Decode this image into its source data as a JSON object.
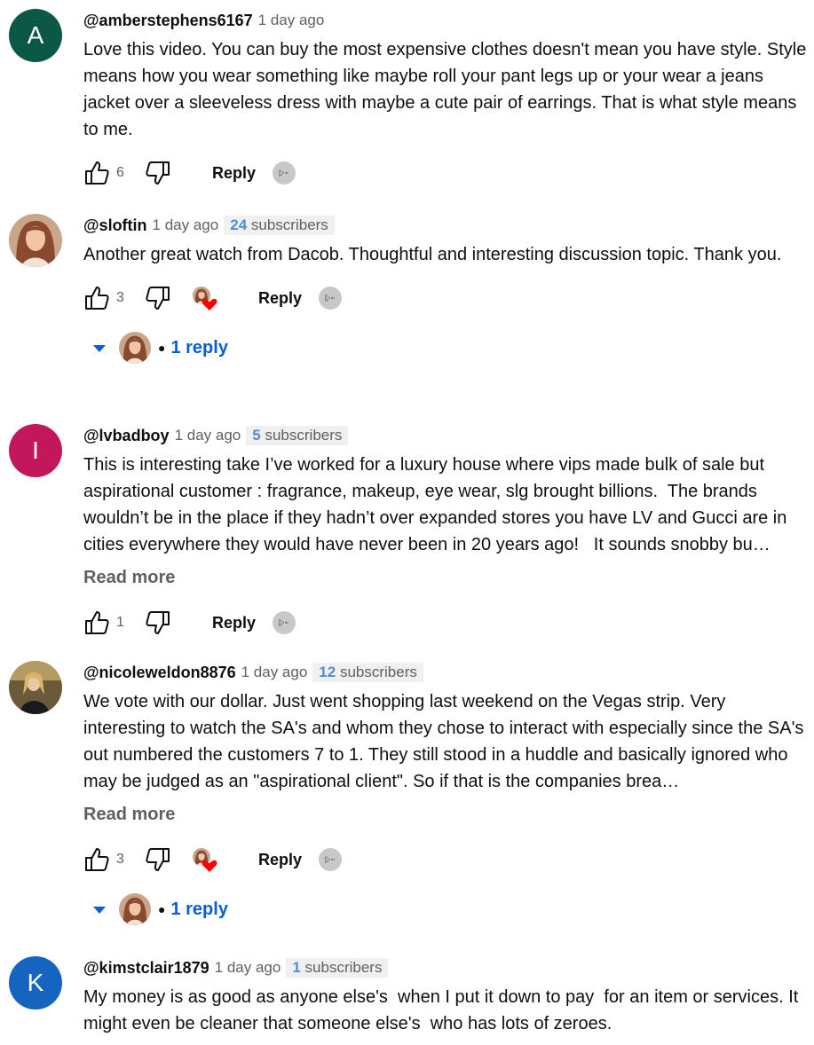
{
  "comments": [
    {
      "avatar_letter": "A",
      "avatar_color": "#0b5847",
      "handle": "@amberstephens6167",
      "time": "1 day ago",
      "text": "Love this video. You can buy the most expensive clothes doesn't mean you have style. Style means how you wear something like maybe roll your pant legs up or your wear a jeans jacket over a sleeveless dress with maybe a cute pair of earrings. That is what style means to me.",
      "likes": "6",
      "reply_label": "Reply"
    },
    {
      "handle": "@sloftin",
      "time": "1 day ago",
      "subs_num": "24",
      "subs_label": "subscribers",
      "text": "Another great watch from Dacob. Thoughtful and interesting discussion topic. Thank you.",
      "likes": "3",
      "reply_label": "Reply",
      "replies_label": "1 reply"
    },
    {
      "avatar_letter": "I",
      "avatar_color": "#c2185b",
      "handle": "@lvbadboy",
      "time": "1 day ago",
      "subs_num": "5",
      "subs_label": "subscribers",
      "text": "This is interesting take I’ve worked for a luxury house where vips made bulk of sale but aspirational customer : fragrance, makeup, eye wear, slg brought billions.  The brands wouldn’t be in the place if they hadn’t over expanded stores you have LV and Gucci are in cities everywhere they would have never been in 20 years ago!   It sounds snobby bu…",
      "read_more": "Read more",
      "likes": "1",
      "reply_label": "Reply"
    },
    {
      "handle": "@nicoleweldon8876",
      "time": "1 day ago",
      "subs_num": "12",
      "subs_label": "subscribers",
      "text": "We vote with our dollar. Just went shopping last weekend on the Vegas strip. Very interesting to watch the SA's and whom they chose to interact with especially since the SA's out numbered the customers 7 to 1. They still stood in a huddle and basically ignored who may be judged as an \"aspirational client\". So if that is the companies brea…",
      "read_more": "Read more",
      "likes": "3",
      "reply_label": "Reply",
      "replies_label": "1 reply"
    },
    {
      "avatar_letter": "K",
      "avatar_color": "#1565c0",
      "handle": "@kimstclair1879",
      "time": "1 day ago",
      "subs_num": "1",
      "subs_label": "subscribers",
      "text": "My money is as good as anyone else's  when I put it down to pay  for an item or services. It might even be cleaner that someone else's  who has lots of zeroes."
    }
  ],
  "icons": {
    "like": "thumbs-up-icon",
    "dislike": "thumbs-down-icon",
    "heart": "creator-heart-icon",
    "extension": "extension-icon",
    "expand": "caret-down-icon"
  },
  "colors": {
    "link_blue": "#065fd4",
    "heart_red": "#ff0000"
  }
}
